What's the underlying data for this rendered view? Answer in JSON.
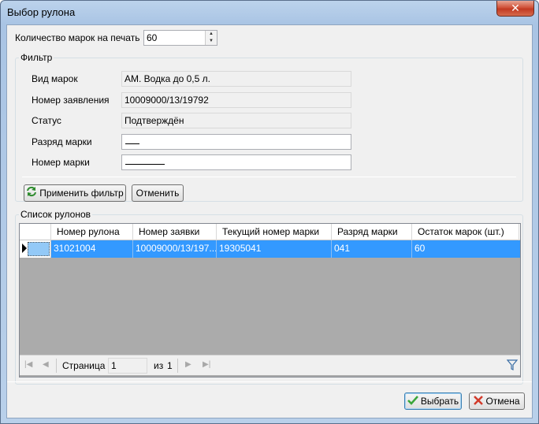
{
  "window": {
    "title": "Выбор рулона",
    "close_glyph": "✕"
  },
  "count": {
    "label": "Количество марок на печать",
    "value": "60"
  },
  "filter": {
    "group_title": "Фильтр",
    "fields": [
      {
        "label": "Вид марок",
        "value": "АМ. Водка до 0,5 л."
      },
      {
        "label": "Номер заявления",
        "value": "10009000/13/19792"
      },
      {
        "label": "Статус",
        "value": "Подтверждён"
      }
    ],
    "editable": [
      {
        "label": "Разряд марки",
        "value": ""
      },
      {
        "label": "Номер марки",
        "value": ""
      }
    ],
    "apply_label": "Применить фильтр",
    "cancel_label": "Отменить"
  },
  "rolls": {
    "group_title": "Список рулонов",
    "columns": [
      "Номер рулона",
      "Номер заявки",
      "Текущий номер марки",
      "Разряд марки",
      "Остаток марок (шт.)"
    ],
    "rows": [
      [
        "31021004",
        "10009000/13/197...",
        "19305041",
        "041",
        "60"
      ]
    ]
  },
  "pager": {
    "page_label": "Страница",
    "page_value": "1",
    "of_label": "из",
    "total": "1"
  },
  "footer": {
    "ok_label": "Выбрать",
    "cancel_label": "Отмена"
  },
  "colors": {
    "selection": "#3399ff",
    "grid_empty": "#ababab",
    "accent_ok": "#3aa63a",
    "accent_cancel": "#d23a2a"
  },
  "icons": [
    "close-icon",
    "spin-up-icon",
    "spin-down-icon",
    "refresh-icon",
    "row-pointer-icon",
    "first-page-icon",
    "prev-page-icon",
    "next-page-icon",
    "last-page-icon",
    "filter-icon",
    "check-icon",
    "cancel-x-icon"
  ]
}
